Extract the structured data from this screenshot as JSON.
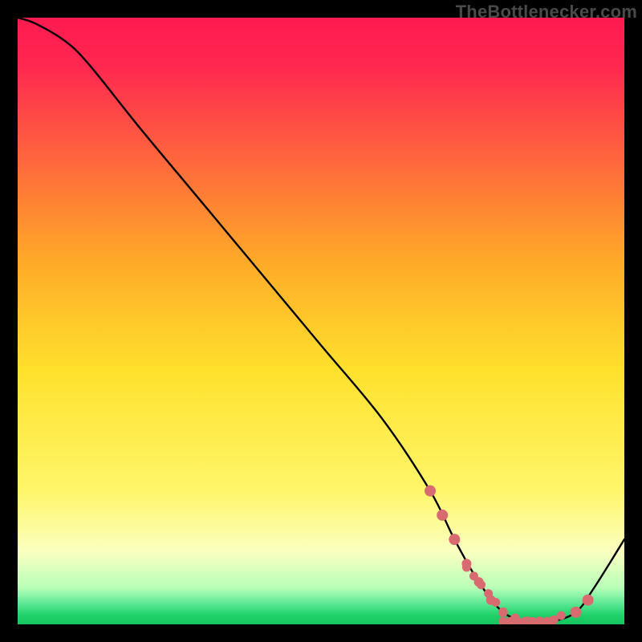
{
  "watermark": "TheBottlenecker.com",
  "colors": {
    "bg": "#000000",
    "curve": "#000000",
    "marker": "#d86b6f",
    "grad_top": "#ff1a4f",
    "grad_mid_upper": "#ffb300",
    "grad_mid": "#ffe936",
    "grad_lower": "#f8ffb0",
    "grad_green": "#22d36a"
  },
  "chart_data": {
    "type": "line",
    "title": "",
    "xlabel": "",
    "ylabel": "",
    "xlim": [
      0,
      100
    ],
    "ylim": [
      0,
      100
    ],
    "curve": {
      "x": [
        0,
        3,
        8,
        12,
        20,
        30,
        40,
        50,
        60,
        68,
        72,
        76,
        80,
        84,
        88,
        92,
        95,
        100
      ],
      "y": [
        100,
        99,
        96,
        92,
        82,
        70,
        58,
        46,
        34,
        22,
        14,
        7,
        2,
        0.5,
        0.5,
        2,
        6,
        14
      ]
    },
    "markers": {
      "x": [
        68,
        70,
        72,
        74,
        76,
        78,
        80,
        82,
        84,
        86,
        88,
        92,
        94
      ],
      "y": [
        22,
        18,
        14,
        10,
        7,
        4,
        2,
        1,
        0.5,
        0.5,
        0.5,
        2,
        4
      ]
    }
  }
}
